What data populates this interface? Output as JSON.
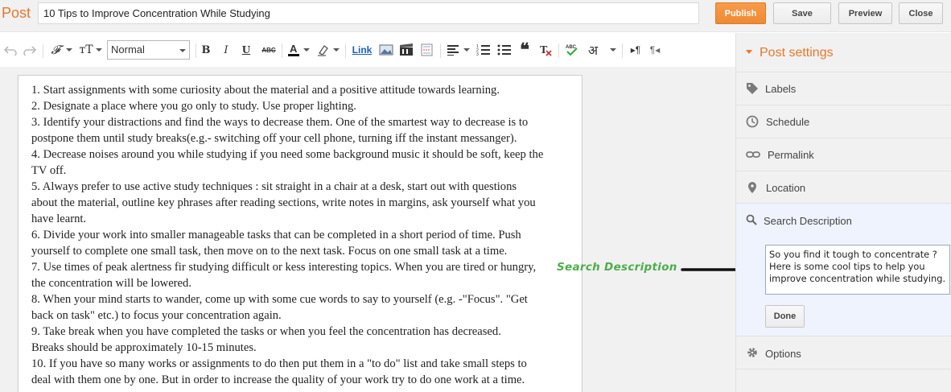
{
  "header": {
    "post_label": "Post",
    "title": "10 Tips to Improve Concentration While Studying",
    "publish": "Publish",
    "save": "Save",
    "preview": "Preview",
    "close": "Close",
    "accent": "#e8772a"
  },
  "toolbar": {
    "format_value": "Normal",
    "bold": "B",
    "italic": "I",
    "underline": "U",
    "strike": "ABC",
    "link": "Link",
    "hindi": "अ",
    "icons": [
      "undo-icon",
      "redo-icon",
      "font-family-icon",
      "font-size-icon",
      "bold-icon",
      "italic-icon",
      "underline-icon",
      "strikethrough-icon",
      "text-color-icon",
      "highlight-icon",
      "image-icon",
      "video-icon",
      "jump-break-icon",
      "align-icon",
      "numbered-list-icon",
      "bullet-list-icon",
      "quote-icon",
      "remove-format-icon",
      "spellcheck-icon",
      "transliterate-icon",
      "ltr-icon",
      "rtl-icon"
    ]
  },
  "editor": {
    "lines": [
      "1. Start assignments with some curiosity about the material and a positive attitude towards learning.",
      "2. Designate a place where you go only to study. Use proper lighting.",
      "3. Identify your distractions and find the ways to decrease them. One of the smartest way to decrease is to",
      "postpone them until study breaks(e.g.- switching off your cell phone, turning iff the instant messanger).",
      "4. Decrease noises around you while studying if you need some background music it should be soft, keep the",
      "TV off.",
      "5. Always prefer to use active study techniques : sit straight in a chair at a desk, start out with questions",
      "about the material, outline key phrases after reading sections, write notes in margins, ask yourself what you",
      "have learnt.",
      "6. Divide your work into smaller manageable tasks that can be completed in a short period of time. Push",
      "yourself to complete one small task, then move on to the next task. Focus on one small task at a time.",
      "7. Use times of peak alertness fir studying difficult or kess interesting topics. When you are tired or hungry,",
      "the concentration will be lowered.",
      "8. When your mind starts to wander, come up with some cue words to say to yourself (e.g. -\"Focus\". \"Get",
      "back on task\" etc.) to focus your concentration again.",
      "9. Take break when you have completed the tasks or when you feel the concentration has decreased.",
      "Breaks should be approximately 10-15 minutes.",
      "10. If you have so many works or assignments to do then put them in a \"to do\" list and take small steps to",
      "deal with them one by one. But in order to increase the quality of your work try to do one work at a time."
    ]
  },
  "annotation": {
    "text": "Search Description",
    "color": "#4cae4c"
  },
  "sidebar": {
    "title": "Post settings",
    "items": [
      {
        "label": "Labels",
        "icon": "tag-icon"
      },
      {
        "label": "Schedule",
        "icon": "clock-icon"
      },
      {
        "label": "Permalink",
        "icon": "link-icon"
      },
      {
        "label": "Location",
        "icon": "location-pin-icon"
      }
    ],
    "search": {
      "label": "Search Description",
      "icon": "search-icon",
      "value": "So you find it tough to concentrate ? Here is some cool tips to help you improve concentration while studying.",
      "done": "Done"
    },
    "options": {
      "label": "Options",
      "icon": "gear-icon"
    }
  }
}
